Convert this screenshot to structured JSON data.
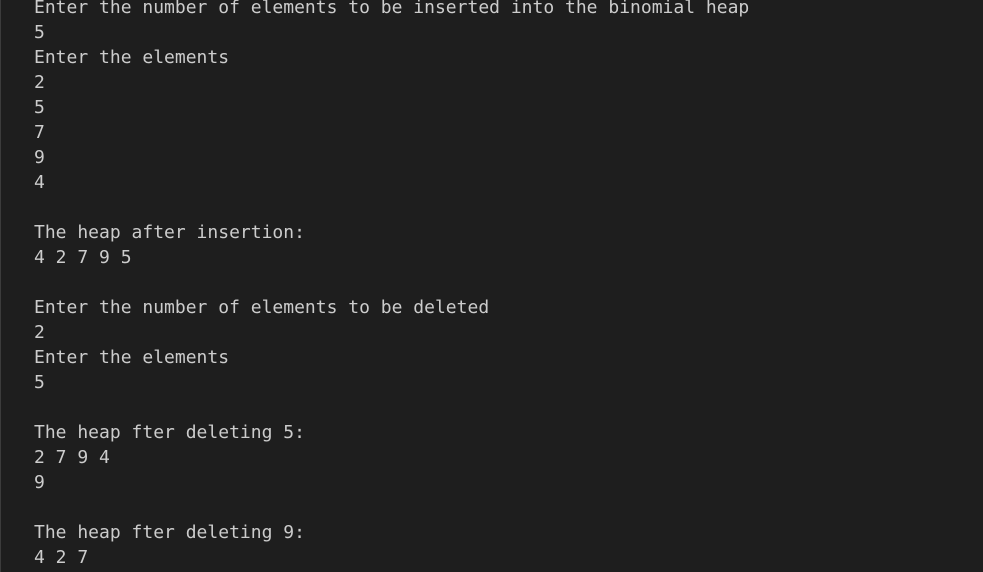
{
  "terminal": {
    "lines": [
      "Enter the number of elements to be inserted into the binomial heap",
      "5",
      "Enter the elements",
      "2",
      "5",
      "7",
      "9",
      "4",
      "",
      "The heap after insertion:",
      "4 2 7 9 5",
      "",
      "Enter the number of elements to be deleted",
      "2",
      "Enter the elements",
      "5",
      "",
      "The heap fter deleting 5:",
      "2 7 9 4",
      "9",
      "",
      "The heap fter deleting 9:",
      "4 2 7"
    ]
  }
}
